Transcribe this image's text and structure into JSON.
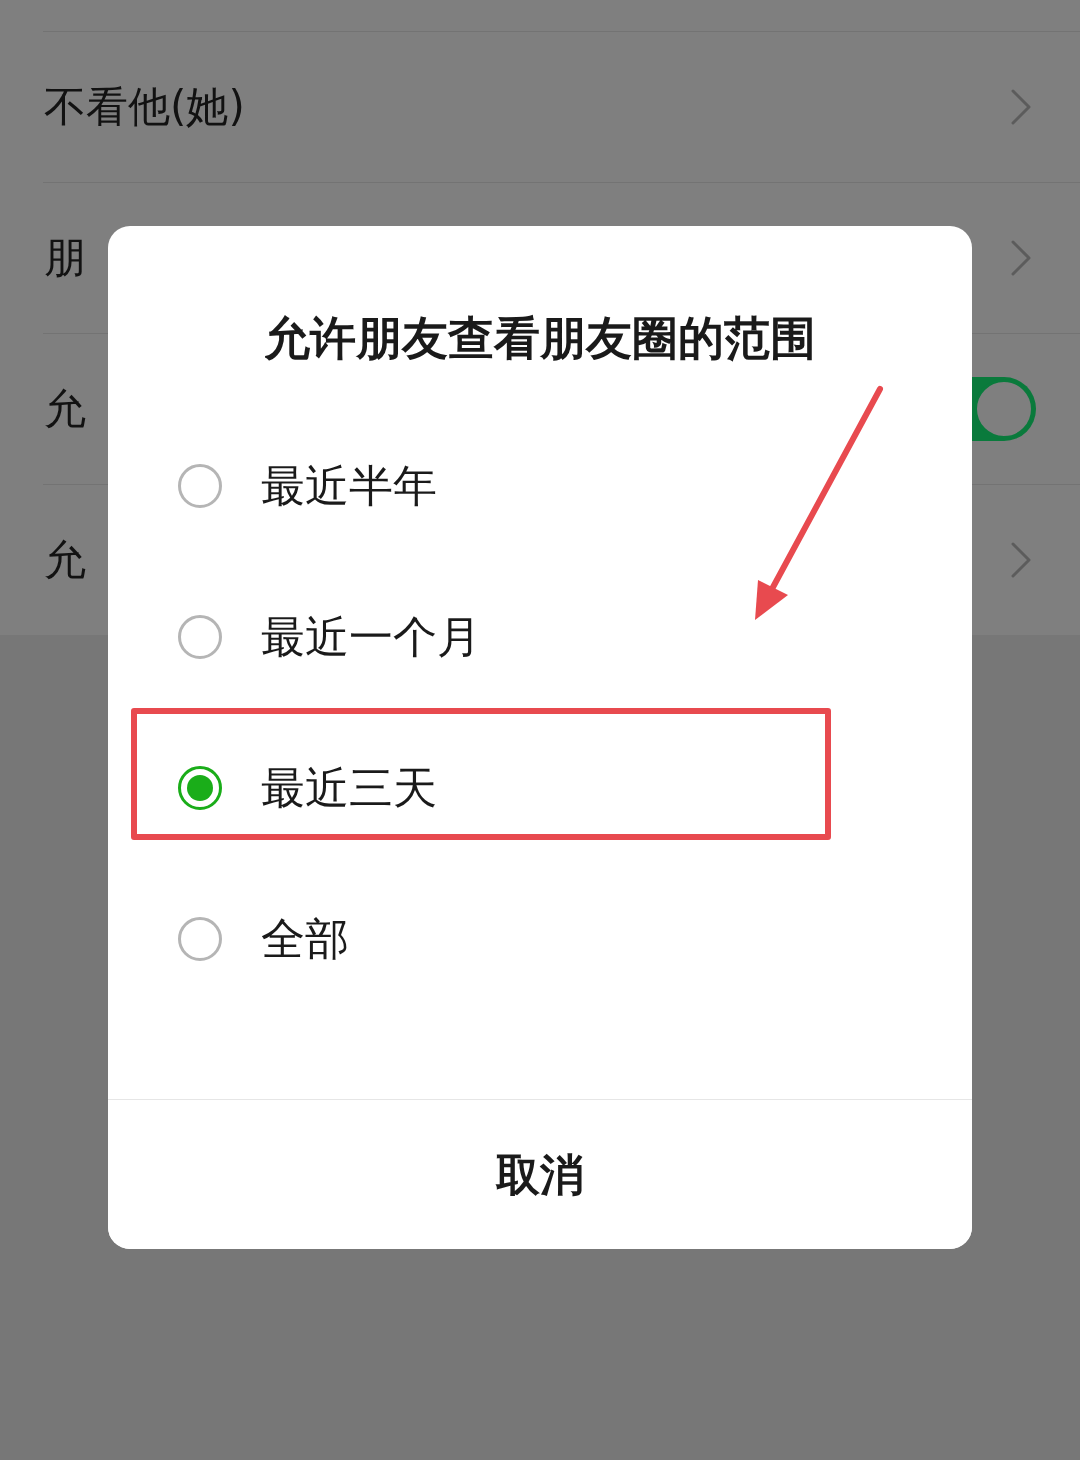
{
  "settings_list": {
    "rows": [
      {
        "kind": "link",
        "label": "不看他(她)"
      },
      {
        "kind": "link",
        "label": "朋"
      },
      {
        "kind": "switch",
        "label": "允",
        "on": true
      },
      {
        "kind": "link",
        "label": "允"
      }
    ]
  },
  "dialog": {
    "title": "允许朋友查看朋友圈的范围",
    "options": [
      {
        "label": "最近半年",
        "selected": false
      },
      {
        "label": "最近一个月",
        "selected": false
      },
      {
        "label": "最近三天",
        "selected": true
      },
      {
        "label": "全部",
        "selected": false
      }
    ],
    "cancel_button": "取消"
  }
}
